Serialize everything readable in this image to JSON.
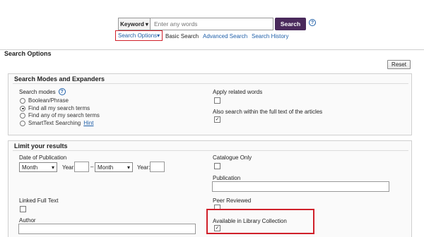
{
  "search": {
    "field_select": "Keyword",
    "placeholder": "Enter any words",
    "button": "Search",
    "help": "?"
  },
  "links": {
    "search_options": "Search Options",
    "basic": "Basic Search",
    "advanced": "Advanced Search",
    "history": "Search History"
  },
  "options": {
    "title": "Search Options",
    "reset": "Reset"
  },
  "modes": {
    "title": "Search Modes and Expanders",
    "label": "Search modes",
    "help": "?",
    "items": [
      {
        "label": "Boolean/Phrase",
        "selected": false
      },
      {
        "label": "Find all my search terms",
        "selected": true
      },
      {
        "label": "Find any of my search terms",
        "selected": false
      },
      {
        "label": "SmartText Searching",
        "selected": false
      }
    ],
    "hint": "Hint",
    "related": {
      "label": "Apply related words",
      "checked": false
    },
    "fulltext": {
      "label": "Also search within the full text of the articles",
      "checked": true
    }
  },
  "limits": {
    "title": "Limit your results",
    "date_label": "Date of Publication",
    "month1": "Month",
    "year1_label": "Year:",
    "dash": "–",
    "month2": "Month",
    "year2_label": "Year:",
    "catalogue": {
      "label": "Catalogue Only",
      "checked": false
    },
    "publication": {
      "label": "Publication",
      "value": ""
    },
    "linked_full_text": {
      "label": "Linked Full Text",
      "checked": false
    },
    "peer_reviewed": {
      "label": "Peer Reviewed",
      "checked": false
    },
    "author": {
      "label": "Author",
      "value": ""
    },
    "library": {
      "label": "Available in Library Collection",
      "checked": true
    }
  }
}
